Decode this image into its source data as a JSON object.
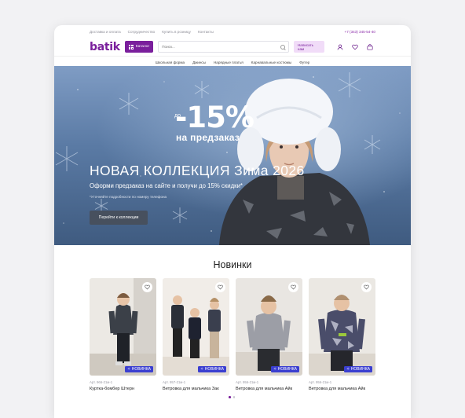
{
  "topbar": {
    "links": [
      "Доставка и оплата",
      "Сотрудничество",
      "Купить в розницу",
      "Контакты"
    ],
    "phone": "+7 (343) 345-54-40"
  },
  "header": {
    "logo": "batik",
    "catalog_label": "Каталог",
    "search_placeholder": "Поиск...",
    "write_us_label": "Написать нам"
  },
  "nav": {
    "items": [
      "Школьная форма",
      "Джинсы",
      "Нарядные платья",
      "Карнавальные костюмы",
      "Футер"
    ]
  },
  "hero": {
    "promo_prefix": "до",
    "promo_value": "-15%",
    "promo_subtitle": "на предзаказ",
    "title": "НОВАЯ КОЛЛЕКЦИЯ Зима 2026",
    "subtitle": "Оформи предзаказ на сайте и получи до 15% скидки*",
    "note": "*Уточняйте подробности по номеру телефона",
    "button": "Перейти к коллекции",
    "slide_count": 3,
    "active_slide": 1
  },
  "new_arrivals": {
    "title": "Новинки",
    "products": [
      {
        "article": "Арт. 966-21м-1",
        "name": "Куртка-бомбер Штерн",
        "badge": "НОВИНКА"
      },
      {
        "article": "Арт. 957-21м-1",
        "name": "Ветровка для мальчика Зак",
        "badge": "НОВИНКА"
      },
      {
        "article": "Арт. 956-21м-1",
        "name": "Ветровка для мальчика Айк",
        "badge": "НОВИНКА"
      },
      {
        "article": "Арт. 956-21м-1",
        "name": "Ветровка для мальчика Айк",
        "badge": "НОВИНКА"
      }
    ],
    "page_count": 2,
    "active_page": 0
  },
  "colors": {
    "brand": "#7a1f9c",
    "badge": "#3b3fd0",
    "write_us_bg": "#f1dcf8"
  },
  "icons": {
    "header": [
      "user-icon",
      "heart-icon",
      "cart-icon"
    ],
    "catalog": "grid-icon",
    "search": "search-icon"
  }
}
